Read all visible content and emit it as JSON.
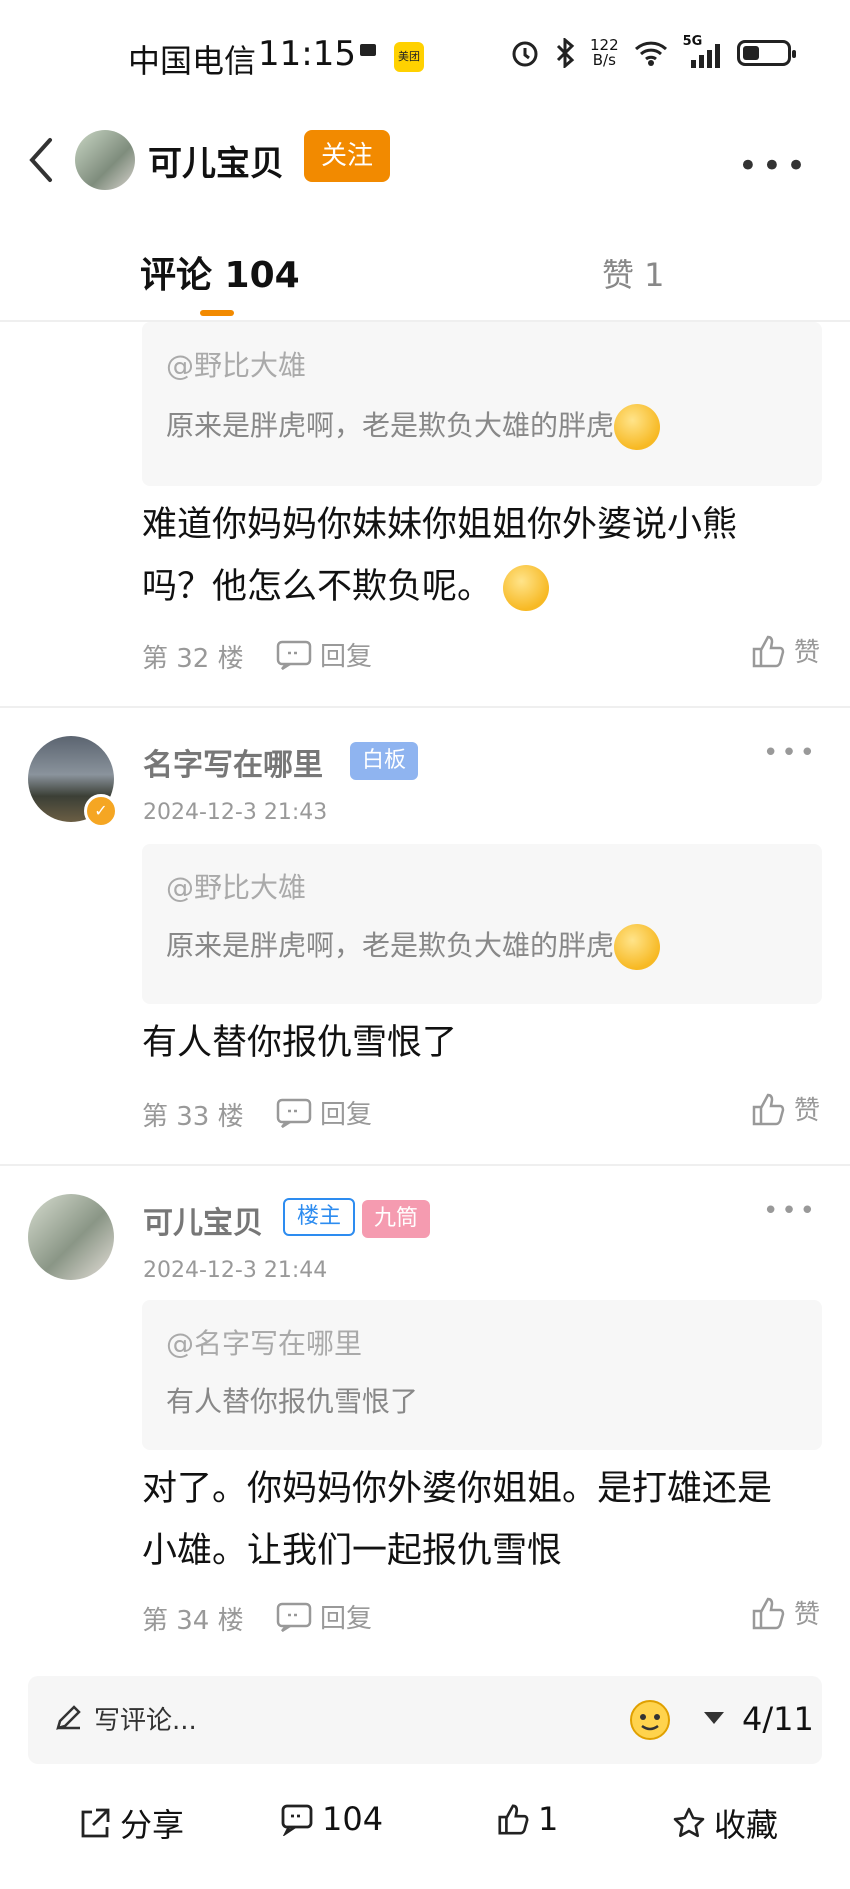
{
  "status_bar": {
    "carrier": "中国电信",
    "time": "11:15",
    "app_badge": "美团",
    "speed_value": "122",
    "speed_unit": "B/s",
    "network": "5G"
  },
  "header": {
    "title": "可儿宝贝",
    "follow_label": "关注"
  },
  "tabs": {
    "comments": "评论 104",
    "likes": "赞 1"
  },
  "comments": [
    {
      "quote_user": "@野比大雄",
      "quote_text": "原来是胖虎啊，老是欺负大雄的胖虎",
      "body_line1": "难道你妈妈你妹妹你姐姐你外婆说小熊",
      "body_line2": "吗？他怎么不欺负呢。",
      "floor": "第 32 楼",
      "reply_label": "回复",
      "like_label": "赞"
    },
    {
      "username": "名字写在哪里",
      "tag": "白板",
      "date": "2024-12-3 21:43",
      "quote_user": "@野比大雄",
      "quote_text": "原来是胖虎啊，老是欺负大雄的胖虎",
      "body_line1": "有人替你报仇雪恨了",
      "floor": "第 33 楼",
      "reply_label": "回复",
      "like_label": "赞"
    },
    {
      "username": "可儿宝贝",
      "tag_owner": "楼主",
      "tag": "九筒",
      "date": "2024-12-3 21:44",
      "quote_user": "@名字写在哪里",
      "quote_text": "有人替你报仇雪恨了",
      "body_line1": "对了。你妈妈你外婆你姐姐。是打雄还是",
      "body_line2": "小雄。让我们一起报仇雪恨",
      "floor": "第 34 楼",
      "reply_label": "回复",
      "like_label": "赞"
    }
  ],
  "composer": {
    "placeholder": "写评论...",
    "page": "4/11"
  },
  "bottom_bar": {
    "share": "分享",
    "comments": "104",
    "likes": "1",
    "favorite": "收藏"
  },
  "colors": {
    "accent": "#f28a00",
    "tag_baiban": "#8fb4f0",
    "tag_owner": "#2d8cf0",
    "tag_jiutong": "#f59bb0"
  }
}
